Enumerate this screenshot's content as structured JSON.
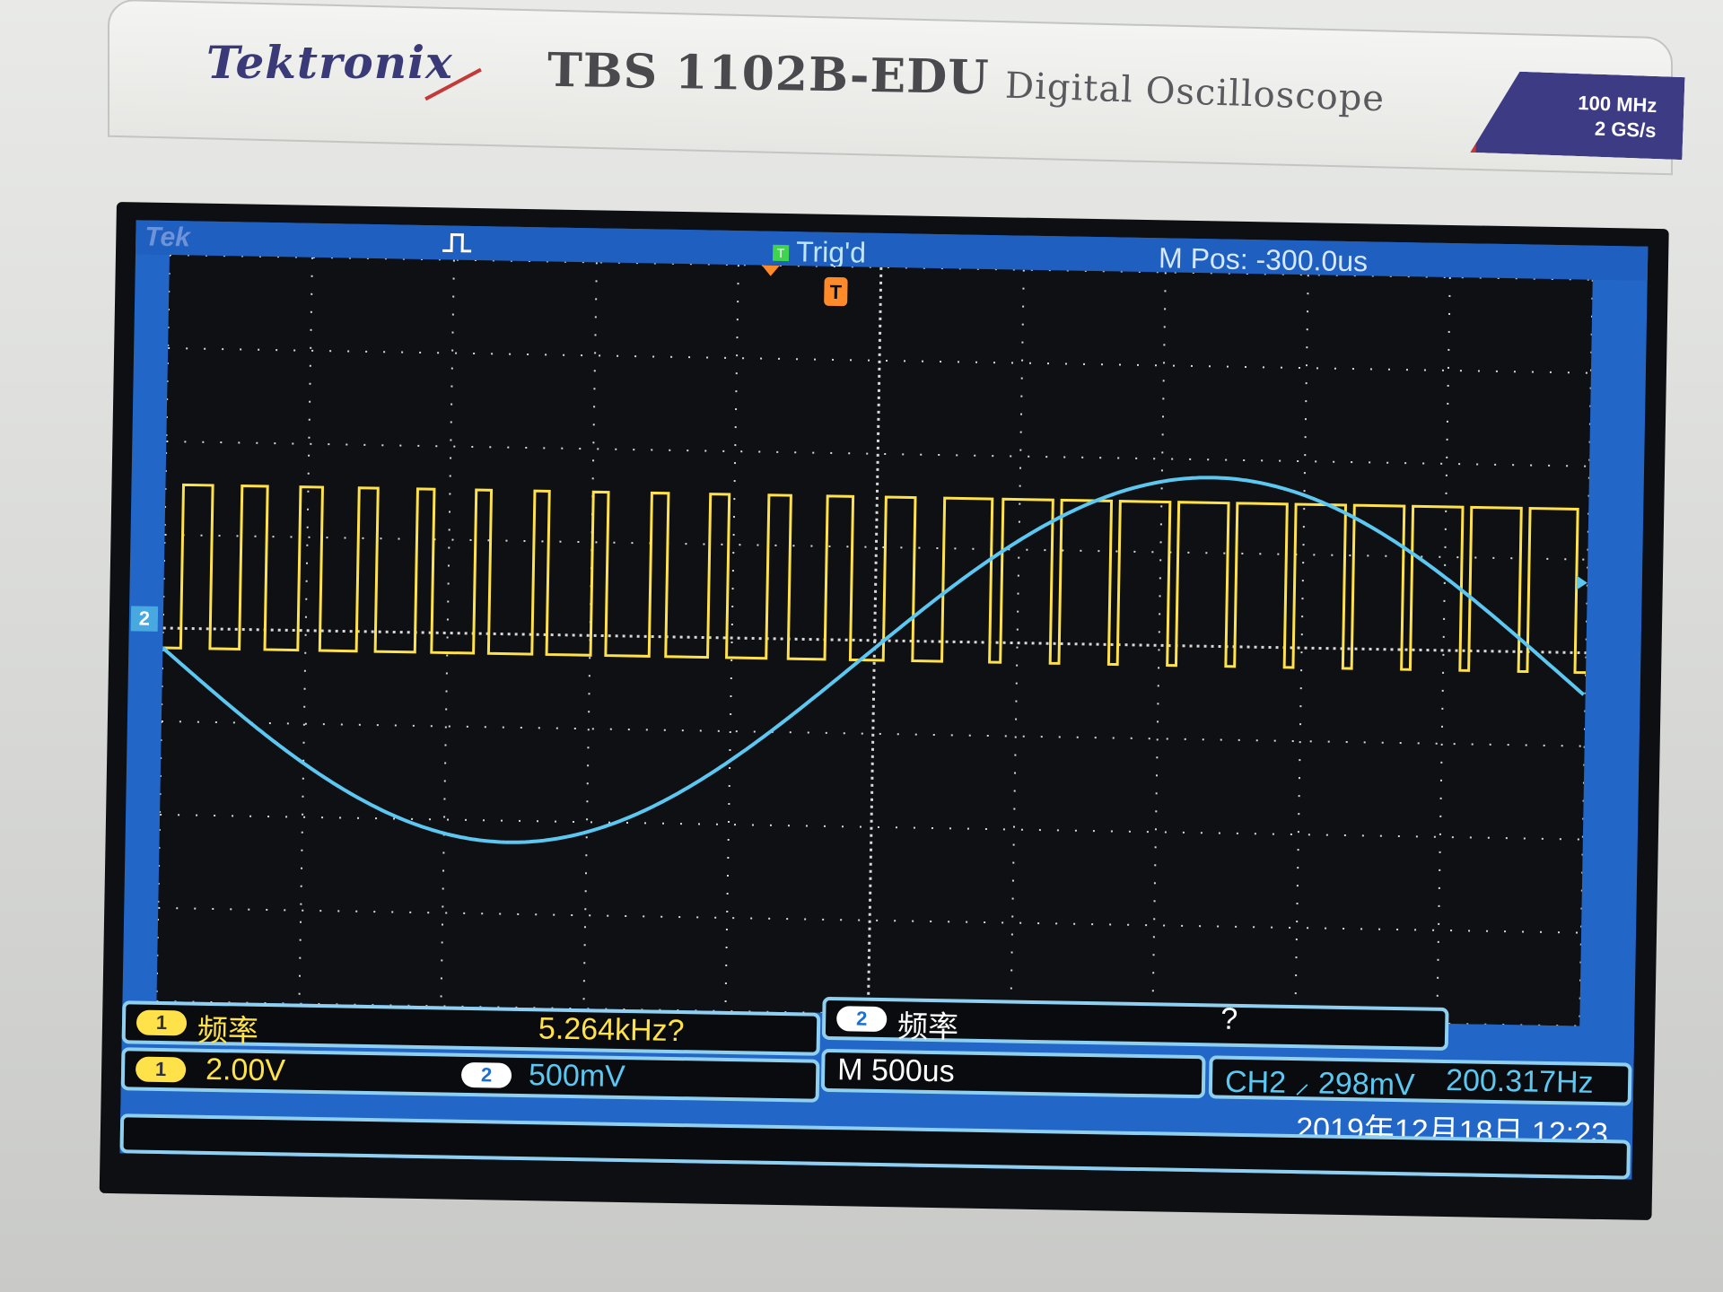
{
  "device": {
    "brand": "Tektronix",
    "model": "TBS 1102B-EDU",
    "description": "Digital Oscilloscope",
    "badge_line1": "100 MHz",
    "badge_line2": "2 GS/s"
  },
  "header": {
    "tek_label": "Tek",
    "trigger_status": "Trig'd",
    "trigger_status_box": "T",
    "main_position": "M Pos: -300.0us"
  },
  "markers": {
    "trigger_marker": "T",
    "ch2_ground_marker": "2"
  },
  "measurements": {
    "ch1_channel": "1",
    "ch1_label": "频率",
    "ch1_value": "5.264kHz?",
    "ch2_channel": "2",
    "ch2_label": "频率",
    "ch2_value": "?"
  },
  "settings": {
    "ch1_channel": "1",
    "ch1_scale": "2.00V",
    "ch2_channel": "2",
    "ch2_scale": "500mV",
    "timebase": "M 500us",
    "trigger_info": "CH2 ⸝ 298mV",
    "trigger_freq": "200.317Hz",
    "datetime": "2019年12月18日 12:23"
  },
  "colors": {
    "ch1": "#ffe24a",
    "ch2": "#5cc8f2",
    "grid": "#d8d8d8",
    "screen_bg": "#0f1014",
    "frame_blue": "#2266c8"
  }
}
